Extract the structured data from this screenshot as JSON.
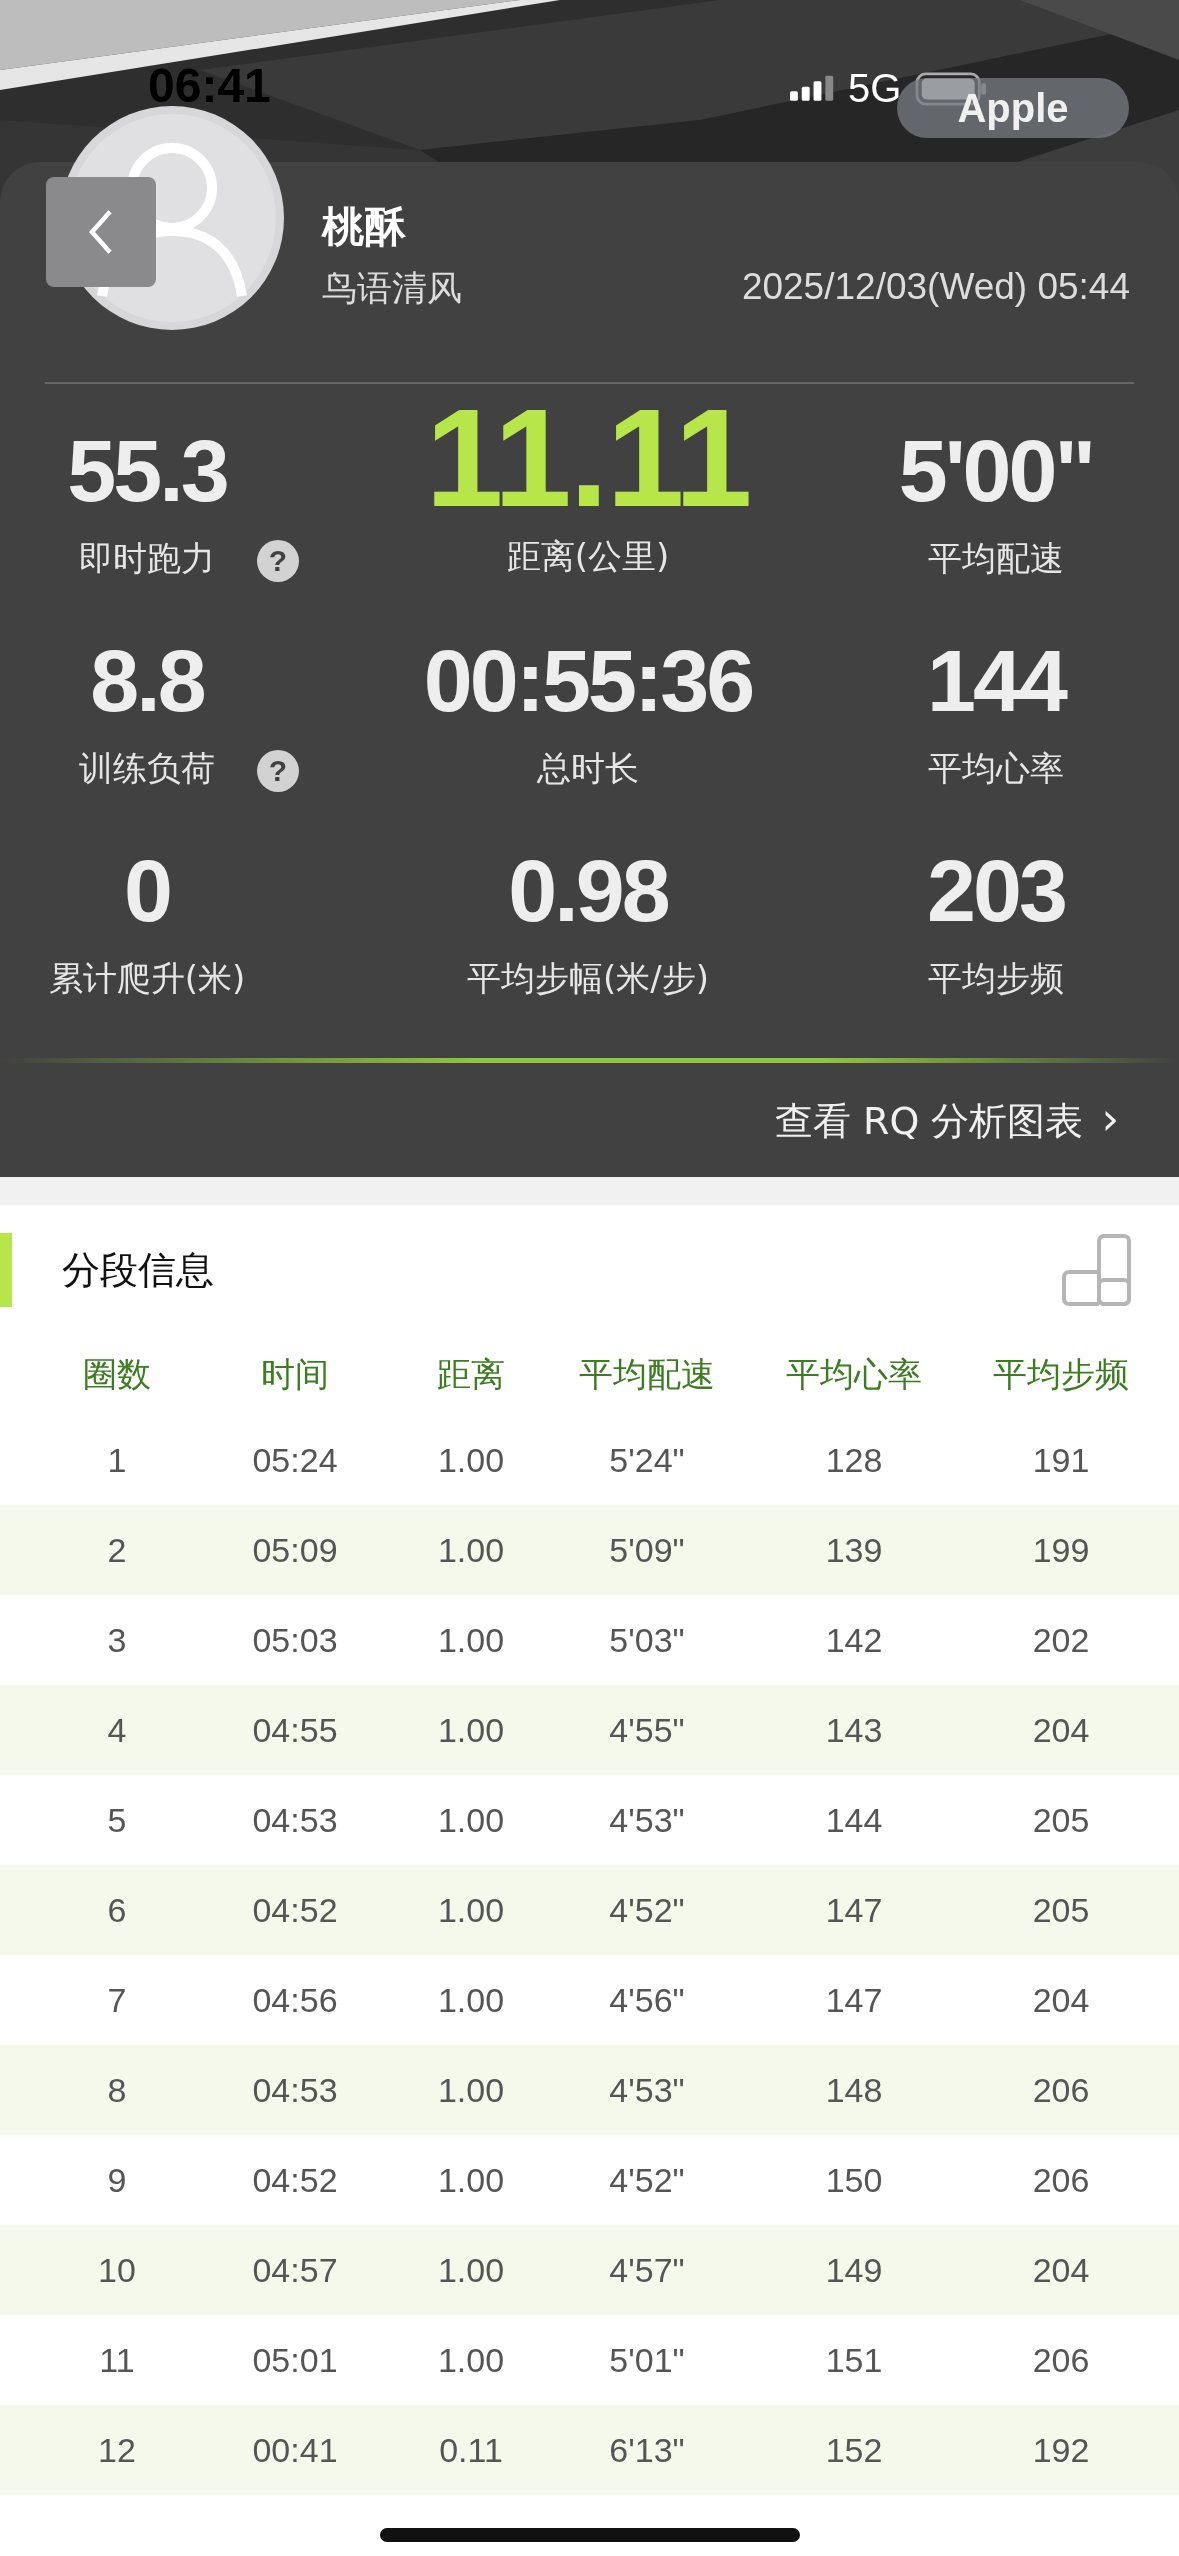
{
  "status_bar": {
    "time": "06:41",
    "network": "5G",
    "pill": "Apple"
  },
  "profile": {
    "name": "桃酥",
    "subtitle": "鸟语清风",
    "datetime": "2025/12/03(Wed) 05:44"
  },
  "stats": [
    {
      "value": "55.3",
      "label": "即时跑力",
      "help": "?",
      "accent": false
    },
    {
      "value": "11.11",
      "label": "距离(公里)",
      "accent": true
    },
    {
      "value": "5'00\"",
      "label": "平均配速",
      "accent": false
    },
    {
      "value": "8.8",
      "label": "训练负荷",
      "help": "?",
      "accent": false
    },
    {
      "value": "00:55:36",
      "label": "总时长",
      "accent": false
    },
    {
      "value": "144",
      "label": "平均心率",
      "accent": false
    },
    {
      "value": "0",
      "label": "累计爬升(米)",
      "accent": false
    },
    {
      "value": "0.98",
      "label": "平均步幅(米/步)",
      "accent": false
    },
    {
      "value": "203",
      "label": "平均步频",
      "accent": false
    }
  ],
  "analysis_link": {
    "label": "查看 RQ 分析图表",
    "chevron": "›"
  },
  "section": {
    "title": "分段信息"
  },
  "table": {
    "columns": [
      "圈数",
      "时间",
      "距离",
      "平均配速",
      "平均心率",
      "平均步频"
    ],
    "rows": [
      [
        "1",
        "05:24",
        "1.00",
        "5'24\"",
        "128",
        "191"
      ],
      [
        "2",
        "05:09",
        "1.00",
        "5'09\"",
        "139",
        "199"
      ],
      [
        "3",
        "05:03",
        "1.00",
        "5'03\"",
        "142",
        "202"
      ],
      [
        "4",
        "04:55",
        "1.00",
        "4'55\"",
        "143",
        "204"
      ],
      [
        "5",
        "04:53",
        "1.00",
        "4'53\"",
        "144",
        "205"
      ],
      [
        "6",
        "04:52",
        "1.00",
        "4'52\"",
        "147",
        "205"
      ],
      [
        "7",
        "04:56",
        "1.00",
        "4'56\"",
        "147",
        "204"
      ],
      [
        "8",
        "04:53",
        "1.00",
        "4'53\"",
        "148",
        "206"
      ],
      [
        "9",
        "04:52",
        "1.00",
        "4'52\"",
        "150",
        "206"
      ],
      [
        "10",
        "04:57",
        "1.00",
        "4'57\"",
        "149",
        "204"
      ],
      [
        "11",
        "05:01",
        "1.00",
        "5'01\"",
        "151",
        "206"
      ],
      [
        "12",
        "00:41",
        "0.11",
        "6'13\"",
        "152",
        "192"
      ]
    ]
  }
}
